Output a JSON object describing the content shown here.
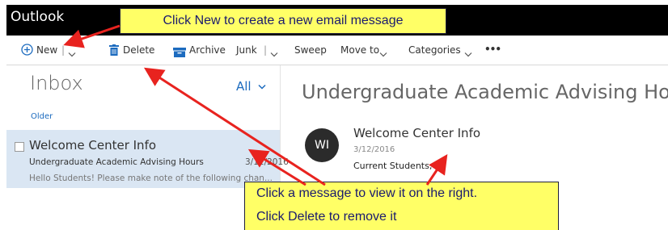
{
  "app": {
    "title": "Outlook"
  },
  "toolbar": {
    "new_label": "New",
    "delete_label": "Delete",
    "archive_label": "Archive",
    "junk_label": "Junk",
    "sweep_label": "Sweep",
    "move_to_label": "Move to",
    "categories_label": "Categories",
    "more_label": "•••"
  },
  "inbox": {
    "title": "Inbox",
    "filter_label": "All",
    "group_label": "Older",
    "message": {
      "from": "Welcome Center Info",
      "subject": "Undergraduate Academic Advising Hours",
      "date": "3/12/2016",
      "preview": "Hello Students!   Please make note of the following chan..."
    }
  },
  "reading": {
    "title": "Undergraduate Academic Advising Hours",
    "avatar_initials": "WI",
    "from": "Welcome Center Info",
    "date": "3/12/2016",
    "body": "Current Students;"
  },
  "callouts": {
    "top": "Click New to create a new email message",
    "bottom_line1": "Click a message to view it on the right.",
    "bottom_line2": "Click Delete to remove it"
  },
  "colors": {
    "accent": "#1c6bbf",
    "selected_row": "#dae6f3",
    "callout_bg": "#ffff66",
    "arrow": "#e8231f"
  }
}
